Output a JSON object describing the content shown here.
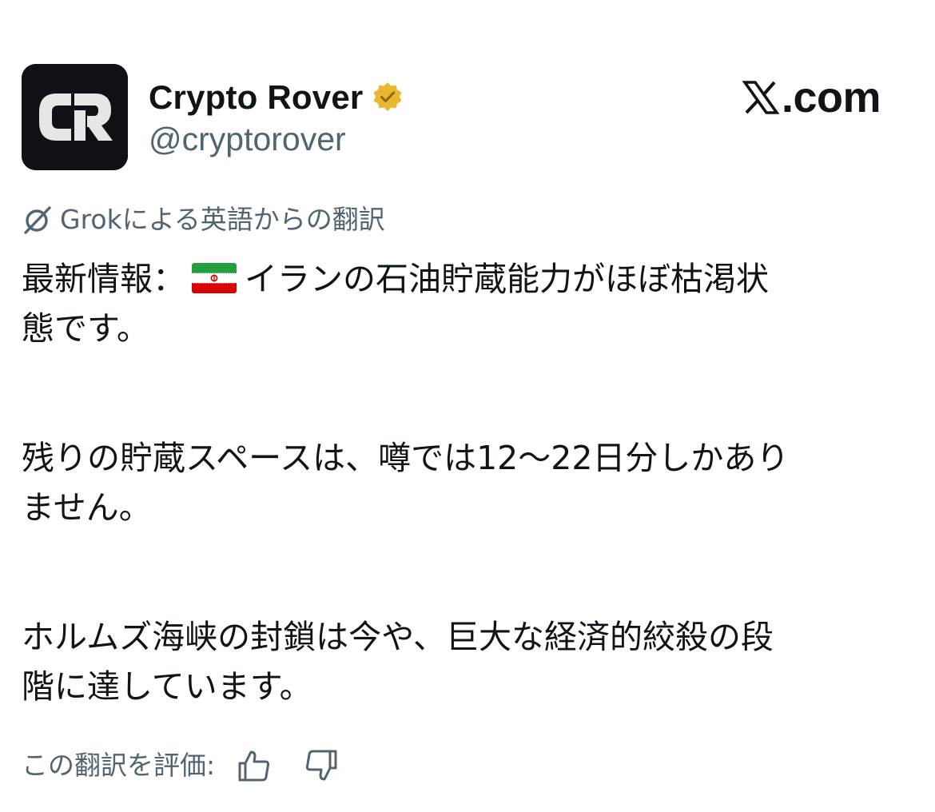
{
  "author": {
    "display_name": "Crypto Rover",
    "handle": "@cryptorover",
    "avatar_text": "CR",
    "verified_badge_icon": "verified-gold-badge-icon",
    "verified_color": "#E8B830"
  },
  "site": {
    "logo_mark_icon": "x-logo-icon",
    "label": ".com"
  },
  "translation": {
    "icon": "grok-icon",
    "label": "Grokによる英語からの翻訳"
  },
  "post": {
    "p1_line1_before_flag": "最新情報：",
    "flag_icon": "iran-flag-icon",
    "p1_line1_after_flag": "イランの石油貯蔵能力がほぼ枯渇状",
    "p1_line2": "態です。",
    "p2_line1": "残りの貯蔵スペースは、噂では12〜22日分しかあり",
    "p2_line2": "ません。",
    "p3_line1": "ホルムズ海峡の封鎖は今や、巨大な経済的絞殺の段",
    "p3_line2": "階に達しています。"
  },
  "rating": {
    "label": "この翻訳を評価:",
    "thumbs_up_icon": "thumbs-up-icon",
    "thumbs_down_icon": "thumbs-down-icon"
  },
  "colors": {
    "text_primary": "#0F1419",
    "text_secondary": "#536471",
    "avatar_bg": "#0F1116",
    "avatar_fg": "#E6E6E6"
  }
}
